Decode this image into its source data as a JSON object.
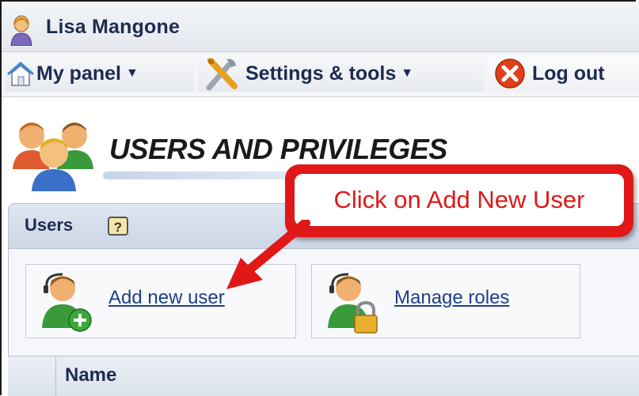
{
  "user": {
    "name": "Lisa Mangone"
  },
  "menu": {
    "my_panel": "My panel",
    "settings_tools": "Settings & tools",
    "log_out": "Log out"
  },
  "page": {
    "title": "USERS AND PRIVILEGES"
  },
  "panel": {
    "title": "Users",
    "help": "?"
  },
  "actions": {
    "add_user": "Add new user",
    "manage_roles": "Manage roles"
  },
  "table": {
    "columns": [
      "Name"
    ]
  },
  "annotation": {
    "callout": "Click on Add New User"
  },
  "colors": {
    "callout": "#e01818",
    "link": "#1f3f86",
    "header_text": "#1d2b4f"
  },
  "icons": [
    "user-icon",
    "home-icon",
    "tools-icon",
    "logout-icon",
    "users-group-icon",
    "help-icon",
    "add-user-icon",
    "manage-roles-icon"
  ]
}
